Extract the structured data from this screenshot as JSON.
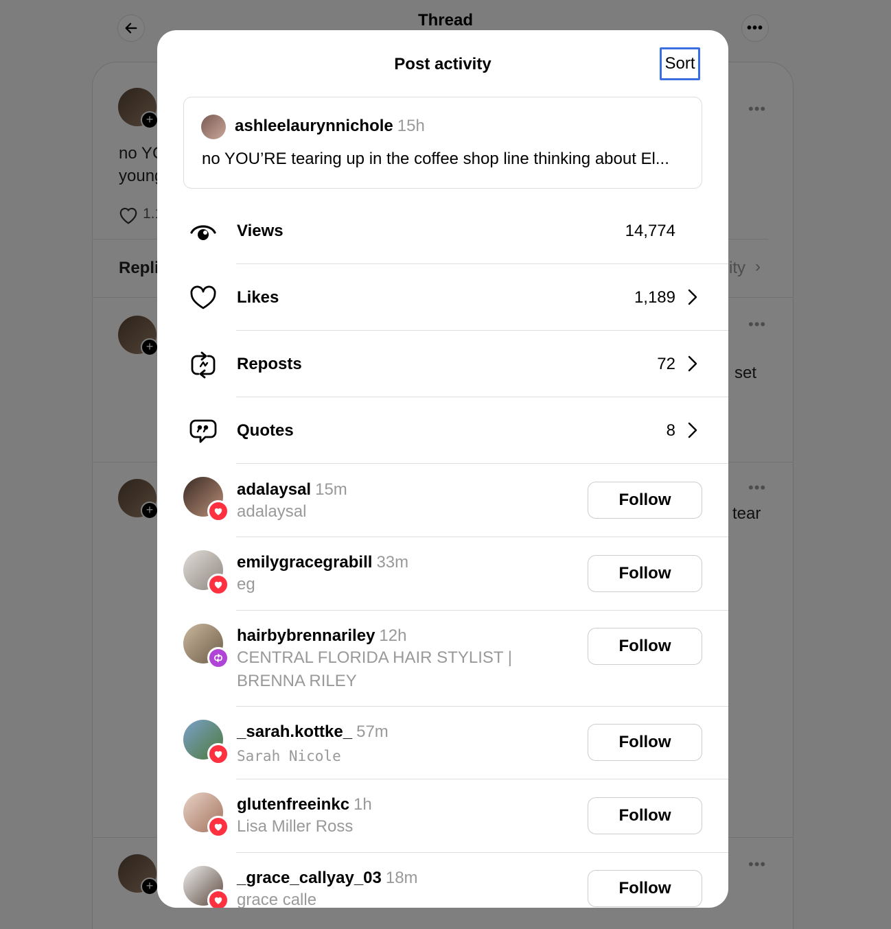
{
  "background": {
    "title": "Thread",
    "snippets": {
      "post_line1": "no YC",
      "post_line2": "young",
      "likes_partial": "1.1",
      "replies_label": "Repli",
      "activity_partial": "ity",
      "set_partial": "set",
      "tear_partial": "tear"
    }
  },
  "modal": {
    "title": "Post activity",
    "sort_label": "Sort",
    "post": {
      "username": "ashleelaurynnichole",
      "time": "15h",
      "text": "no YOU’RE tearing up in the coffee shop line thinking about El..."
    },
    "stats": [
      {
        "label": "Views",
        "value": "14,774",
        "icon": "eye-icon"
      },
      {
        "label": "Likes",
        "value": "1,189",
        "icon": "heart-icon"
      },
      {
        "label": "Reposts",
        "value": "72",
        "icon": "repost-icon"
      },
      {
        "label": "Quotes",
        "value": "8",
        "icon": "quote-icon"
      }
    ],
    "users": [
      {
        "username": "adalaysal",
        "time": "15m",
        "subtitle": "adalaysal",
        "badge": "heart",
        "follow": "Follow"
      },
      {
        "username": "emilygracegrabill",
        "time": "33m",
        "subtitle": "eg",
        "badge": "heart",
        "follow": "Follow"
      },
      {
        "username": "hairbybrennariley",
        "time": "12h",
        "subtitle": "CENTRAL FLORIDA HAIR STYLIST | BRENNA RILEY",
        "badge": "repost",
        "follow": "Follow"
      },
      {
        "username": "_sarah.kottke_",
        "time": "57m",
        "subtitle": "Sarah Nicole",
        "badge": "heart",
        "follow": "Follow"
      },
      {
        "username": "glutenfreeinkc",
        "time": "1h",
        "subtitle": "Lisa Miller Ross",
        "badge": "heart",
        "follow": "Follow"
      },
      {
        "username": "_grace_callyay_03",
        "time": "18m",
        "subtitle": "grace calle",
        "badge": "heart",
        "follow": "Follow"
      }
    ],
    "colors": {
      "like_badge": "#ff3040",
      "repost_badge": "#b044d6",
      "focus": "#3a6ee0"
    }
  }
}
